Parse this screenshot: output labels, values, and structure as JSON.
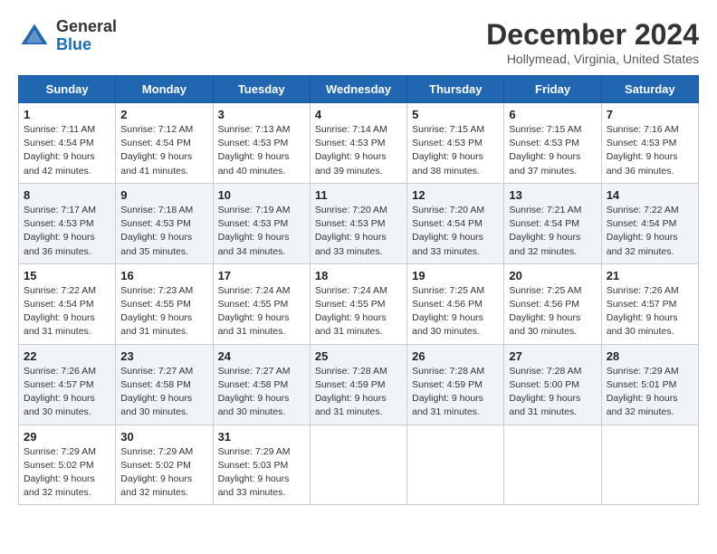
{
  "logo": {
    "general": "General",
    "blue": "Blue"
  },
  "title": "December 2024",
  "location": "Hollymead, Virginia, United States",
  "days_of_week": [
    "Sunday",
    "Monday",
    "Tuesday",
    "Wednesday",
    "Thursday",
    "Friday",
    "Saturday"
  ],
  "weeks": [
    [
      {
        "day": "1",
        "sunrise": "7:11 AM",
        "sunset": "4:54 PM",
        "daylight": "9 hours and 42 minutes."
      },
      {
        "day": "2",
        "sunrise": "7:12 AM",
        "sunset": "4:54 PM",
        "daylight": "9 hours and 41 minutes."
      },
      {
        "day": "3",
        "sunrise": "7:13 AM",
        "sunset": "4:53 PM",
        "daylight": "9 hours and 40 minutes."
      },
      {
        "day": "4",
        "sunrise": "7:14 AM",
        "sunset": "4:53 PM",
        "daylight": "9 hours and 39 minutes."
      },
      {
        "day": "5",
        "sunrise": "7:15 AM",
        "sunset": "4:53 PM",
        "daylight": "9 hours and 38 minutes."
      },
      {
        "day": "6",
        "sunrise": "7:15 AM",
        "sunset": "4:53 PM",
        "daylight": "9 hours and 37 minutes."
      },
      {
        "day": "7",
        "sunrise": "7:16 AM",
        "sunset": "4:53 PM",
        "daylight": "9 hours and 36 minutes."
      }
    ],
    [
      {
        "day": "8",
        "sunrise": "7:17 AM",
        "sunset": "4:53 PM",
        "daylight": "9 hours and 36 minutes."
      },
      {
        "day": "9",
        "sunrise": "7:18 AM",
        "sunset": "4:53 PM",
        "daylight": "9 hours and 35 minutes."
      },
      {
        "day": "10",
        "sunrise": "7:19 AM",
        "sunset": "4:53 PM",
        "daylight": "9 hours and 34 minutes."
      },
      {
        "day": "11",
        "sunrise": "7:20 AM",
        "sunset": "4:53 PM",
        "daylight": "9 hours and 33 minutes."
      },
      {
        "day": "12",
        "sunrise": "7:20 AM",
        "sunset": "4:54 PM",
        "daylight": "9 hours and 33 minutes."
      },
      {
        "day": "13",
        "sunrise": "7:21 AM",
        "sunset": "4:54 PM",
        "daylight": "9 hours and 32 minutes."
      },
      {
        "day": "14",
        "sunrise": "7:22 AM",
        "sunset": "4:54 PM",
        "daylight": "9 hours and 32 minutes."
      }
    ],
    [
      {
        "day": "15",
        "sunrise": "7:22 AM",
        "sunset": "4:54 PM",
        "daylight": "9 hours and 31 minutes."
      },
      {
        "day": "16",
        "sunrise": "7:23 AM",
        "sunset": "4:55 PM",
        "daylight": "9 hours and 31 minutes."
      },
      {
        "day": "17",
        "sunrise": "7:24 AM",
        "sunset": "4:55 PM",
        "daylight": "9 hours and 31 minutes."
      },
      {
        "day": "18",
        "sunrise": "7:24 AM",
        "sunset": "4:55 PM",
        "daylight": "9 hours and 31 minutes."
      },
      {
        "day": "19",
        "sunrise": "7:25 AM",
        "sunset": "4:56 PM",
        "daylight": "9 hours and 30 minutes."
      },
      {
        "day": "20",
        "sunrise": "7:25 AM",
        "sunset": "4:56 PM",
        "daylight": "9 hours and 30 minutes."
      },
      {
        "day": "21",
        "sunrise": "7:26 AM",
        "sunset": "4:57 PM",
        "daylight": "9 hours and 30 minutes."
      }
    ],
    [
      {
        "day": "22",
        "sunrise": "7:26 AM",
        "sunset": "4:57 PM",
        "daylight": "9 hours and 30 minutes."
      },
      {
        "day": "23",
        "sunrise": "7:27 AM",
        "sunset": "4:58 PM",
        "daylight": "9 hours and 30 minutes."
      },
      {
        "day": "24",
        "sunrise": "7:27 AM",
        "sunset": "4:58 PM",
        "daylight": "9 hours and 30 minutes."
      },
      {
        "day": "25",
        "sunrise": "7:28 AM",
        "sunset": "4:59 PM",
        "daylight": "9 hours and 31 minutes."
      },
      {
        "day": "26",
        "sunrise": "7:28 AM",
        "sunset": "4:59 PM",
        "daylight": "9 hours and 31 minutes."
      },
      {
        "day": "27",
        "sunrise": "7:28 AM",
        "sunset": "5:00 PM",
        "daylight": "9 hours and 31 minutes."
      },
      {
        "day": "28",
        "sunrise": "7:29 AM",
        "sunset": "5:01 PM",
        "daylight": "9 hours and 32 minutes."
      }
    ],
    [
      {
        "day": "29",
        "sunrise": "7:29 AM",
        "sunset": "5:02 PM",
        "daylight": "9 hours and 32 minutes."
      },
      {
        "day": "30",
        "sunrise": "7:29 AM",
        "sunset": "5:02 PM",
        "daylight": "9 hours and 32 minutes."
      },
      {
        "day": "31",
        "sunrise": "7:29 AM",
        "sunset": "5:03 PM",
        "daylight": "9 hours and 33 minutes."
      },
      null,
      null,
      null,
      null
    ]
  ],
  "labels": {
    "sunrise": "Sunrise:",
    "sunset": "Sunset:",
    "daylight": "Daylight:"
  }
}
